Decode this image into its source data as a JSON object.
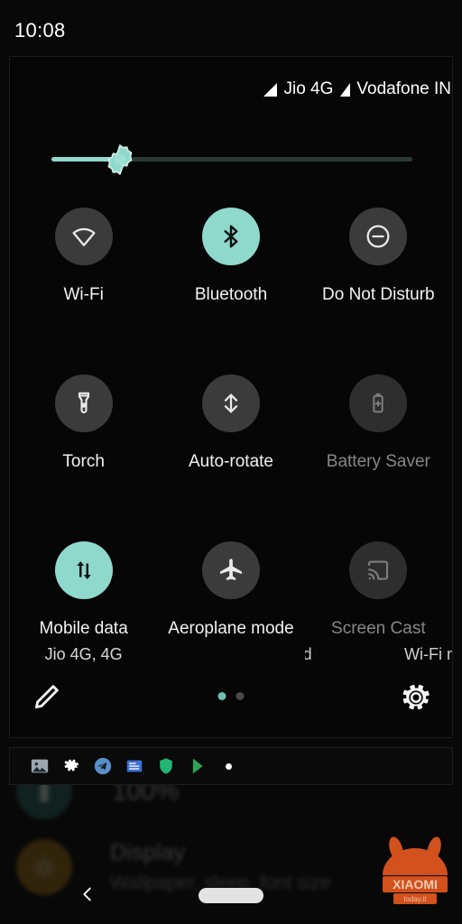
{
  "statusbar": {
    "clock": "10:08",
    "carriers": [
      {
        "name": "Jio 4G",
        "signal_icon": "signal-triangle-icon"
      },
      {
        "name": "Vodafone IN",
        "signal_icon": "signal-triangle-icon"
      }
    ]
  },
  "brightness": {
    "label": "Brightness",
    "value_percent": 19,
    "thumb_icon": "brightness-sun-icon",
    "fill_color": "#8fd8cc",
    "track_color": "#2b3a39"
  },
  "accent_color": "#8fd8cc",
  "tile_off_color": "#3b3b3b",
  "tiles": [
    {
      "name": "wifi",
      "label": "Wi-Fi",
      "icon": "wifi-icon",
      "state": "off",
      "subtitle": ""
    },
    {
      "name": "bluetooth",
      "label": "Bluetooth",
      "icon": "bluetooth-icon",
      "state": "on",
      "subtitle": ""
    },
    {
      "name": "do-not-disturb",
      "label": "Do Not Disturb",
      "icon": "minus-circle-icon",
      "state": "off",
      "subtitle": ""
    },
    {
      "name": "torch",
      "label": "Torch",
      "icon": "flashlight-icon",
      "state": "off",
      "subtitle": ""
    },
    {
      "name": "auto-rotate",
      "label": "Auto-rotate",
      "icon": "auto-rotate-icon",
      "state": "off",
      "subtitle": ""
    },
    {
      "name": "battery-saver",
      "label": "Battery Saver",
      "icon": "battery-plus-icon",
      "state": "unavailable",
      "subtitle": ""
    },
    {
      "name": "mobile-data",
      "label": "Mobile data",
      "icon": "data-arrows-icon",
      "state": "on",
      "subtitle": "Jio 4G, 4G"
    },
    {
      "name": "aeroplane-mode",
      "label": "Aeroplane mode",
      "icon": "airplane-icon",
      "state": "off",
      "subtitle": ""
    },
    {
      "name": "screen-cast",
      "label": "Screen Cast",
      "icon": "cast-icon",
      "state": "unavailable",
      "subtitle_left_clipped": "ed",
      "subtitle_right_clipped": "Wi-Fi no"
    }
  ],
  "footer": {
    "edit_icon": "pencil-icon",
    "settings_icon": "gear-icon",
    "pages": 2,
    "active_page": 1
  },
  "notification_icons": [
    {
      "name": "gallery-icon",
      "color": "#9aa7ae"
    },
    {
      "name": "settings-gear-icon",
      "color": "#ffffff"
    },
    {
      "name": "telegram-icon",
      "color": "#5b8fc9"
    },
    {
      "name": "news-document-icon",
      "color": "#3f6fd8"
    },
    {
      "name": "shield-icon",
      "color": "#22b573"
    },
    {
      "name": "play-store-icon",
      "color": "#2ea35a"
    },
    {
      "name": "more-notifications-dot",
      "color": "#ffffff"
    }
  ],
  "background_app": {
    "battery_row": {
      "icon": "battery-icon",
      "value": "100%"
    },
    "display_row": {
      "icon": "brightness-sun-icon",
      "title": "Display",
      "subtitle": "Wallpaper, sleep, font size"
    }
  },
  "navbar": {
    "back_icon": "back-chevron-icon",
    "home_pill": "home-pill"
  },
  "watermark": {
    "brand": "XIAOMI",
    "site": "today.it",
    "color": "#e2571e"
  }
}
